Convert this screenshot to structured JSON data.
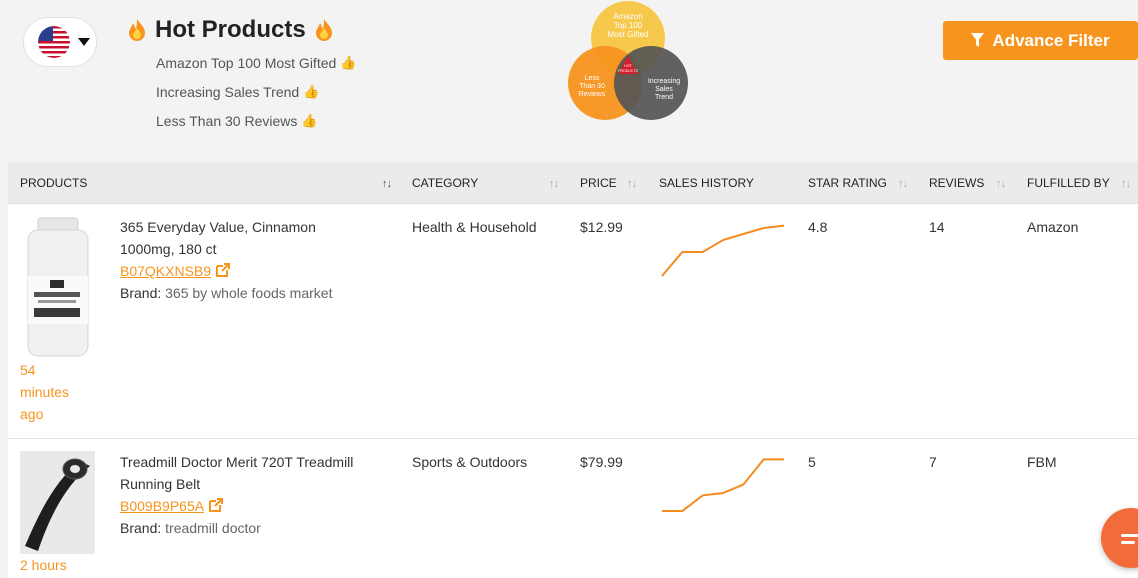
{
  "header": {
    "title": "Hot Products",
    "criteria": [
      "Amazon Top 100 Most Gifted",
      "Increasing Sales Trend",
      "Less Than 30 Reviews"
    ],
    "advance_filter_label": "Advance Filter",
    "venn": {
      "top": [
        "Amazon",
        "Top 100",
        "Most Gifted"
      ],
      "left": [
        "Less",
        "Than 30",
        "Reviews"
      ],
      "right": [
        "Increasing",
        "Sales",
        "Trend"
      ],
      "center": [
        "HOT",
        "PRODUCTS"
      ]
    }
  },
  "table": {
    "columns": [
      "PRODUCTS",
      "CATEGORY",
      "PRICE",
      "SALES HISTORY",
      "STAR RATING",
      "REVIEWS",
      "FULFILLED BY"
    ],
    "rows": [
      {
        "title_line1": "365 Everyday Value, Cinnamon",
        "title_line2": "1000mg, 180 ct",
        "asin": "B07QKXNSB9",
        "brand_label": "Brand:",
        "brand": "365 by whole foods market",
        "ago_lines": [
          "54",
          "minutes",
          "ago"
        ],
        "category": "Health & Household",
        "price": "$12.99",
        "rating": "4.8",
        "reviews": "14",
        "fulfilled_by": "Amazon",
        "sales_history": [
          1,
          3,
          3,
          4,
          4.5,
          5,
          5.2
        ]
      },
      {
        "title_line1": "Treadmill Doctor Merit 720T Treadmill",
        "title_line2": "Running Belt",
        "asin": "B009B9P65A",
        "brand_label": "Brand:",
        "brand": "treadmill doctor",
        "ago_lines": [
          "2 hours"
        ],
        "category": "Sports & Outdoors",
        "price": "$79.99",
        "rating": "5",
        "reviews": "7",
        "fulfilled_by": "FBM",
        "sales_history": [
          1,
          1,
          2.3,
          2.5,
          3.2,
          5.3,
          5.3
        ]
      }
    ]
  },
  "colors": {
    "accent": "#f7941d",
    "chart_line": "#f58a1f",
    "header_bg": "#ebebeb"
  }
}
